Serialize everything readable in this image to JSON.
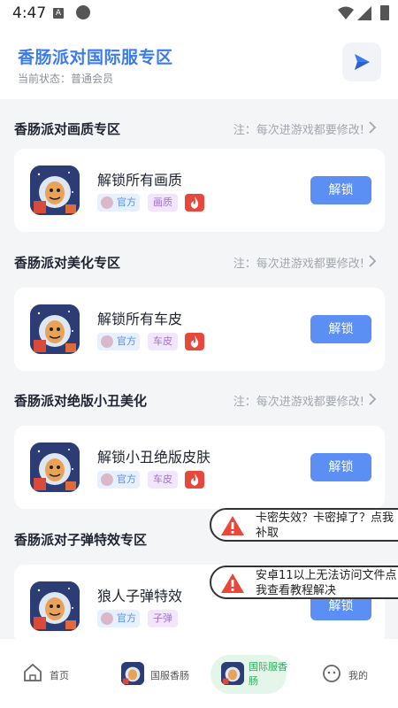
{
  "status_bar": {
    "time": "4:47",
    "notif_letter": "A"
  },
  "header": {
    "title": "香肠派对国际服专区",
    "status": "当前状态：普通会员"
  },
  "sections": [
    {
      "title": "香肠派对画质专区",
      "note": "注：每次进游戏都要修改!",
      "card": {
        "title": "解锁所有画质",
        "official": "官方",
        "category": "画质",
        "button": "解锁"
      }
    },
    {
      "title": "香肠派对美化专区",
      "note": "注：每次进游戏都要修改!",
      "card": {
        "title": "解锁所有车皮",
        "official": "官方",
        "category": "车皮",
        "button": "解锁"
      }
    },
    {
      "title": "香肠派对绝版小丑美化",
      "note": "注：每次进游戏都要修改!",
      "card": {
        "title": "解锁小丑绝版皮肤",
        "official": "官方",
        "category": "车皮",
        "button": "解锁"
      }
    },
    {
      "title": "香肠派对子弹特效专区",
      "card": {
        "title": "狼人子弹特效",
        "official": "官方",
        "category": "子弹",
        "button": "解锁"
      }
    }
  ],
  "toasts": [
    {
      "text": "卡密失效？卡密掉了？点我补取"
    },
    {
      "text": "安卓11以上无法访问文件点我查看教程解决"
    }
  ],
  "nav": [
    {
      "label": "首页",
      "icon": "home-icon"
    },
    {
      "label": "国服香肠",
      "icon": "game-thumb"
    },
    {
      "label": "国际服香肠",
      "icon": "game-thumb",
      "active": true
    },
    {
      "label": "我的",
      "icon": "face-icon"
    }
  ],
  "colors": {
    "accent": "#5b8ff4",
    "title_blue": "#3a7bf0",
    "fire_red": "#e8473c",
    "nav_active_bg": "#e4f6ea",
    "nav_active_text": "#2fae5a"
  }
}
